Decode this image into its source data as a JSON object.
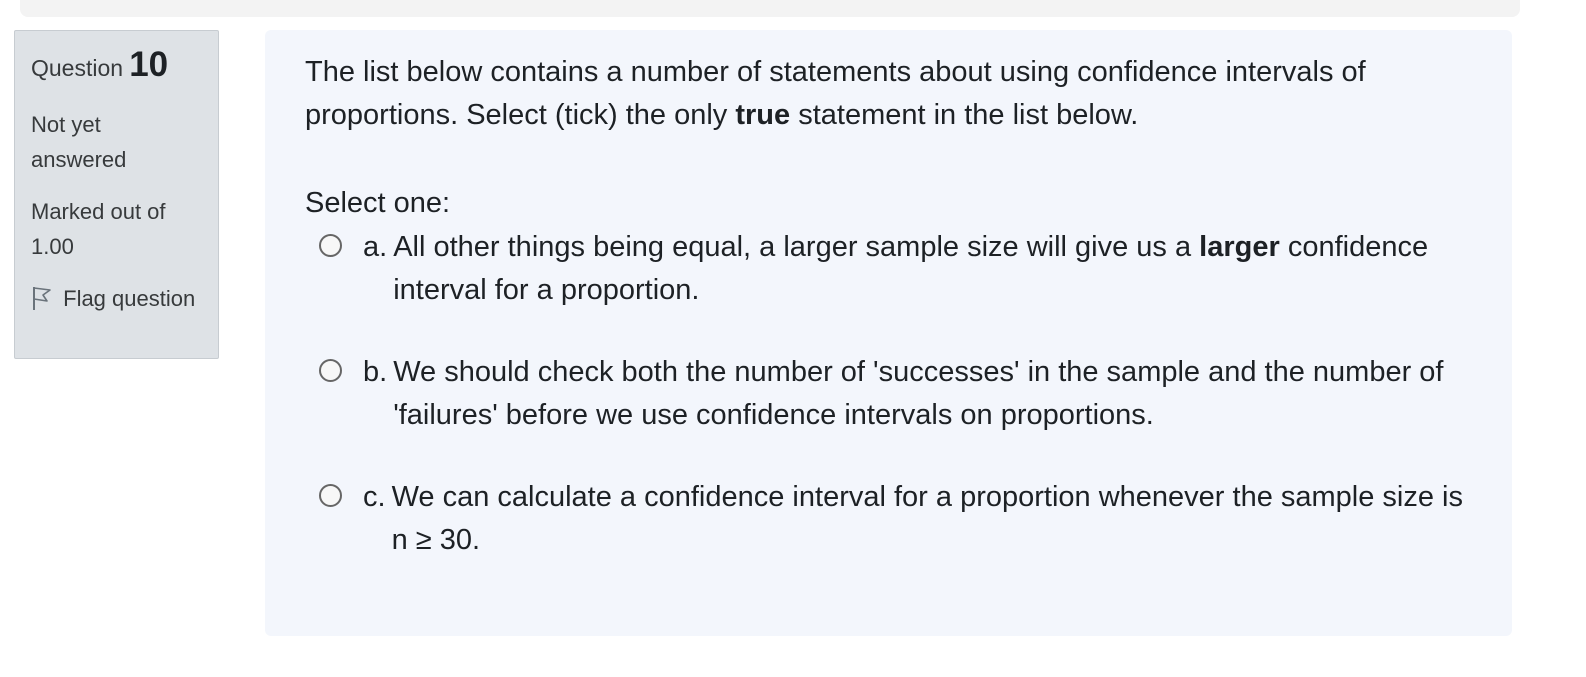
{
  "info": {
    "question_word": "Question",
    "question_number": "10",
    "state": "Not yet answered",
    "grade": "Marked out of 1.00",
    "flag_label": "Flag question"
  },
  "question": {
    "text_before": "The list below contains a number of statements about using confidence intervals of proportions.  Select (tick) the only ",
    "text_bold": "true",
    "text_after": " statement in the list below.",
    "prompt": "Select one:"
  },
  "options": [
    {
      "letter": "a.",
      "text_before": "All other things being equal, a larger sample size will give us a ",
      "text_bold": "larger",
      "text_after": " confidence interval for a proportion."
    },
    {
      "letter": "b.",
      "text": "We should check both the number of 'successes' in the sample and the number of 'failures' before we use confidence intervals on proportions."
    },
    {
      "letter": "c.",
      "text": "We can calculate a confidence interval for a proportion whenever the sample size is n ≥ 30."
    }
  ],
  "icons": {
    "flag": "flag-outline-icon"
  }
}
